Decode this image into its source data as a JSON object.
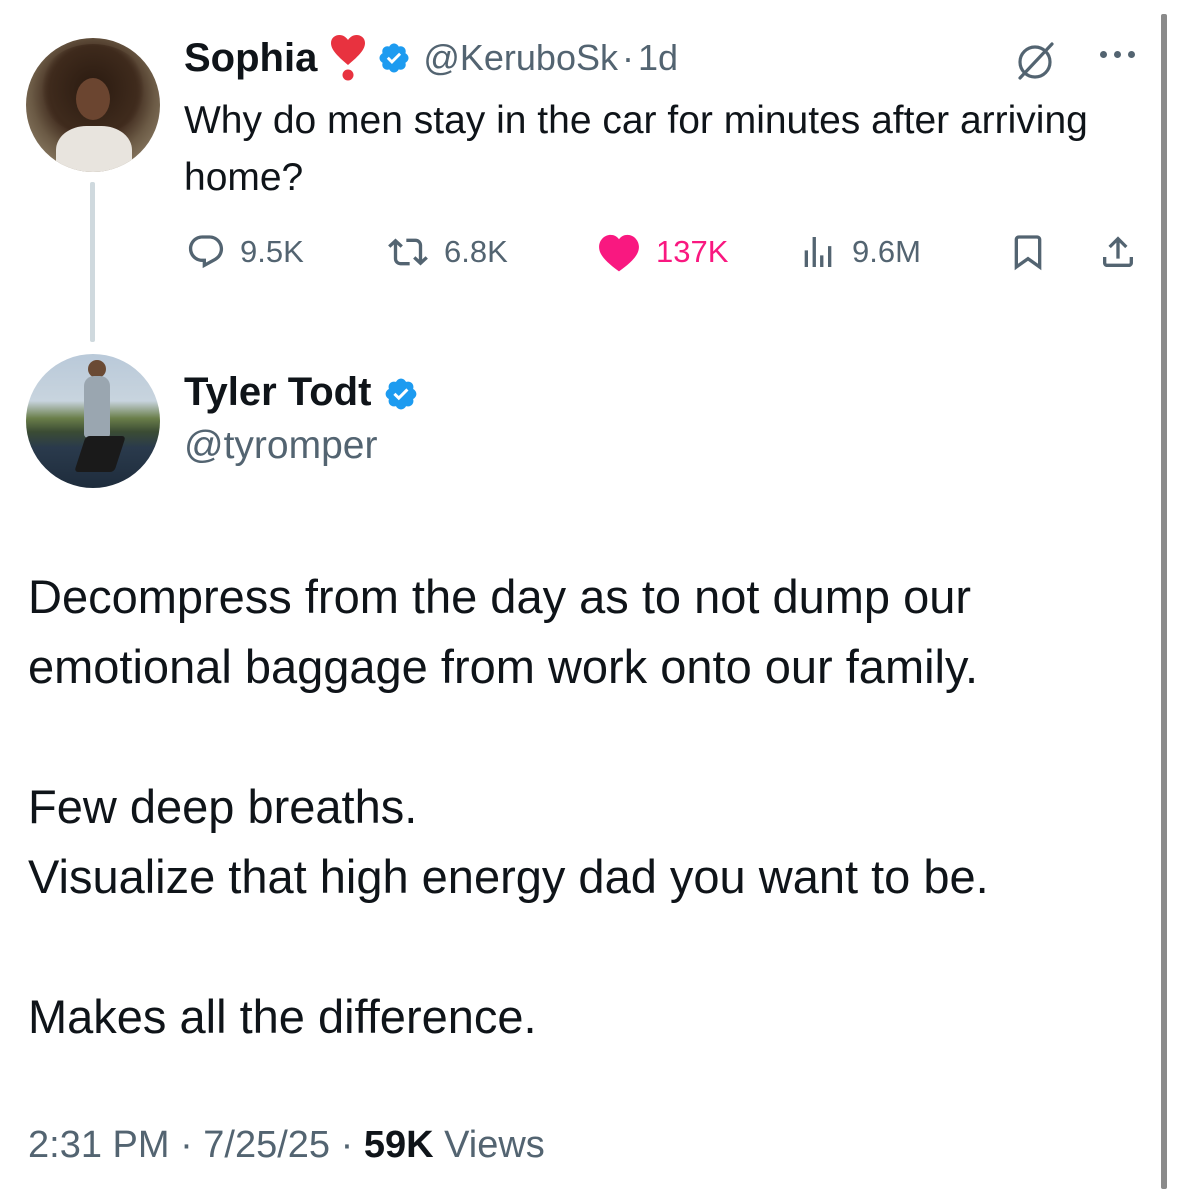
{
  "parent_tweet": {
    "name": "Sophia",
    "name_emoji": "heart-exclamation-emoji",
    "verified": true,
    "handle": "@KeruboSk",
    "separator": "·",
    "time": "1d",
    "text": "Why do men stay in the car for minutes after arriving home?",
    "metrics": {
      "replies": "9.5K",
      "retweets": "6.8K",
      "likes": "137K",
      "views": "9.6M"
    },
    "liked": true,
    "colors": {
      "like": "#f91880",
      "verified": "#1d9bf0",
      "secondary_text": "#536471"
    }
  },
  "reply_tweet": {
    "name": "Tyler Todt",
    "verified": true,
    "handle": "@tyromper",
    "paragraphs": [
      [
        "Decompress from the day as to not dump our emotional baggage from work onto our family."
      ],
      [
        "Few deep breaths.",
        "Visualize that high energy dad you want to be."
      ],
      [
        "Makes all the difference."
      ]
    ],
    "timestamp": "2:31 PM · 7/25/25 · ",
    "views_count": "59K",
    "views_label": " Views"
  }
}
